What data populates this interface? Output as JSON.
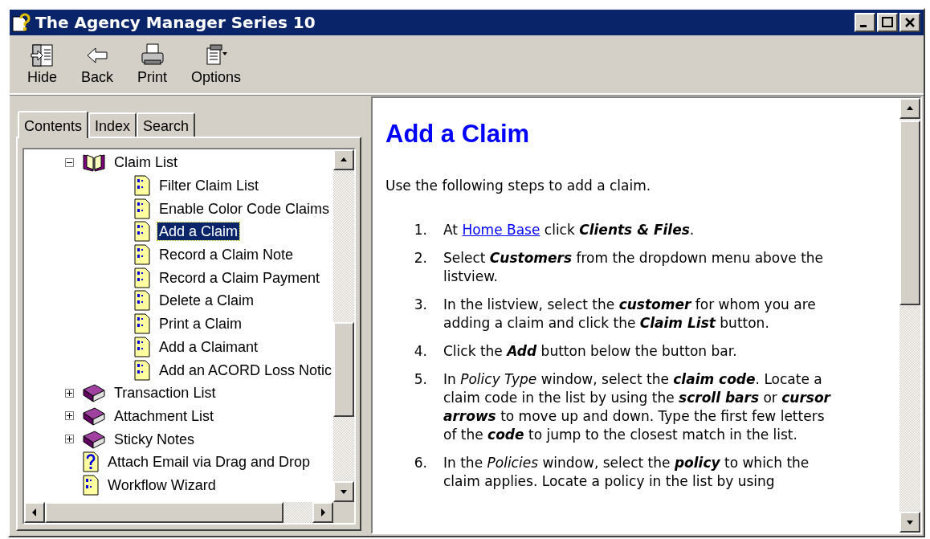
{
  "window": {
    "title": "The Agency Manager Series 10"
  },
  "toolbar": [
    {
      "label": "Hide",
      "kind": "hide"
    },
    {
      "label": "Back",
      "kind": "back"
    },
    {
      "label": "Print",
      "kind": "print"
    },
    {
      "label": "Options",
      "kind": "options"
    }
  ],
  "tabs": [
    {
      "label": "Contents",
      "selected": true
    },
    {
      "label": "Index",
      "selected": false
    },
    {
      "label": "Search",
      "selected": false
    }
  ],
  "tree": [
    {
      "label": "Claim List",
      "kind": "book",
      "expanded": true,
      "selected": false,
      "children": [
        {
          "label": "Filter Claim List",
          "kind": "page",
          "selected": false
        },
        {
          "label": "Enable Color Code Claims",
          "kind": "page",
          "selected": false
        },
        {
          "label": "Add a Claim",
          "kind": "page",
          "selected": true
        },
        {
          "label": "Record a Claim Note",
          "kind": "page",
          "selected": false
        },
        {
          "label": "Record a Claim Payment",
          "kind": "page",
          "selected": false
        },
        {
          "label": "Delete a Claim",
          "kind": "page",
          "selected": false
        },
        {
          "label": "Print a Claim",
          "kind": "page",
          "selected": false
        },
        {
          "label": "Add a Claimant",
          "kind": "page",
          "selected": false
        },
        {
          "label": "Add an ACORD Loss Notic",
          "kind": "page",
          "selected": false
        }
      ]
    },
    {
      "label": "Transaction List",
      "kind": "book",
      "expanded": false,
      "selected": false
    },
    {
      "label": "Attachment List",
      "kind": "book",
      "expanded": false,
      "selected": false
    },
    {
      "label": "Sticky Notes",
      "kind": "book",
      "expanded": false,
      "selected": false
    },
    {
      "label": "Attach Email via Drag and Drop",
      "kind": "help",
      "selected": false
    },
    {
      "label": "Workflow Wizard",
      "kind": "page",
      "selected": false
    }
  ],
  "article": {
    "title": "Add a Claim",
    "intro": "Use the following steps to add a claim.",
    "steps": [
      {
        "number": "1.",
        "before": "At ",
        "link": "Home Base",
        "after": " click **Clients & Files**."
      },
      {
        "number": "2.",
        "text": "Select **Customers** from the dropdown menu above the listview."
      },
      {
        "number": "3.",
        "text": "In the listview, select the **customer** for whom you are adding a claim and click the **Claim List** button."
      },
      {
        "number": "4.",
        "text": "Click the **Add** button below the button bar."
      },
      {
        "number": "5.",
        "text": "In *Policy Type* window, select the **claim code**. Locate a claim code in the list by using the **scroll bars** or **cursor arrows** to move up and down. Type the first few letters of the **code** to jump to the closest match in the list."
      },
      {
        "number": "6.",
        "text": "In the *Policies* window, select the **policy** to which the claim applies. Locate a policy in the list by using"
      }
    ]
  }
}
